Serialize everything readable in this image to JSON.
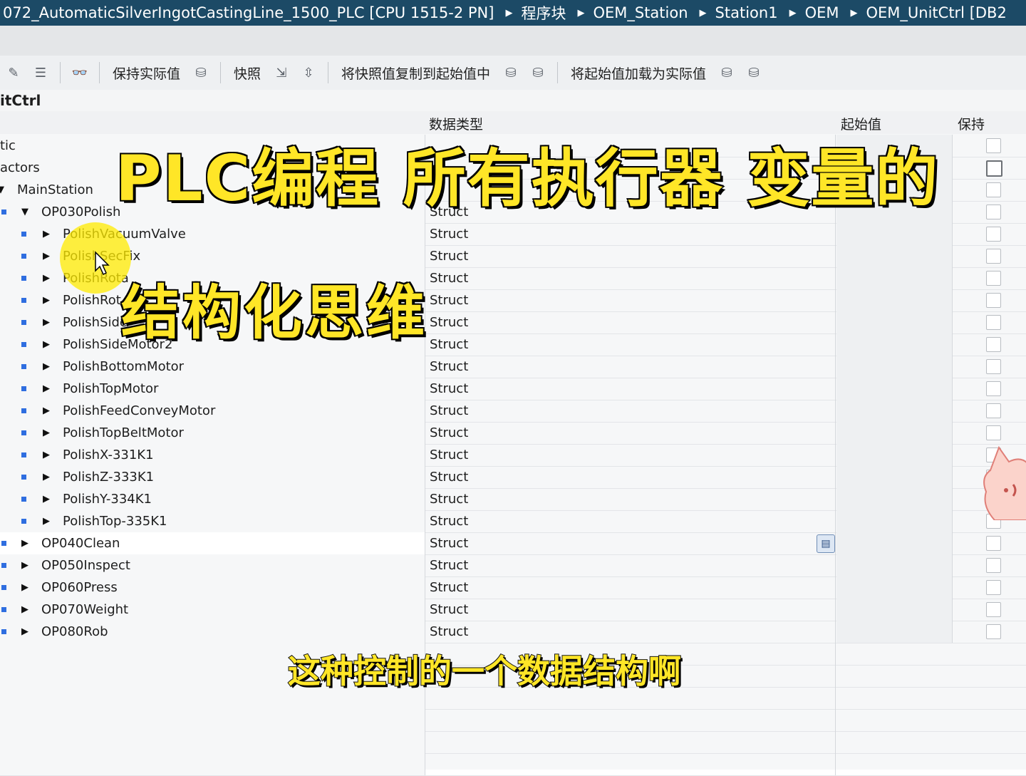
{
  "breadcrumb": {
    "items": [
      "072_AutomaticSilverIngotCastingLine_1500_PLC [CPU 1515-2 PN]",
      "程序块",
      "OEM_Station",
      "Station1",
      "OEM",
      "OEM_UnitCtrl [DB2"
    ]
  },
  "toolbar": {
    "keep_actual": "保持实际值",
    "snapshot": "快照",
    "copy_snapshot": "将快照值复制到起始值中",
    "load_start": "将起始值加载为实际值"
  },
  "block": {
    "title": "itCtrl"
  },
  "columns": {
    "name": "",
    "data_type": "数据类型",
    "start_value": "起始值",
    "retain": "保持"
  },
  "rows": [
    {
      "name": "tic",
      "type": "",
      "level": 0,
      "expanded": null,
      "bullet": false
    },
    {
      "name": "actors",
      "type": "",
      "level": 0,
      "expanded": null,
      "bullet": false
    },
    {
      "name": "MainStation",
      "type": "",
      "level": 1,
      "expanded": true,
      "bullet": false
    },
    {
      "name": "OP030Polish",
      "type": "Struct",
      "level": 2,
      "expanded": true,
      "bullet": true
    },
    {
      "name": "PolishVacuumValve",
      "type": "Struct",
      "level": 3,
      "expanded": false,
      "bullet": true
    },
    {
      "name": "PolishSecFix",
      "type": "Struct",
      "level": 3,
      "expanded": false,
      "bullet": true
    },
    {
      "name": "PolishRota",
      "type": "Struct",
      "level": 3,
      "expanded": false,
      "bullet": true
    },
    {
      "name": "PolishRot",
      "type": "Struct",
      "level": 3,
      "expanded": false,
      "bullet": true
    },
    {
      "name": "PolishSide",
      "type": "Struct",
      "level": 3,
      "expanded": false,
      "bullet": true
    },
    {
      "name": "PolishSideMotor2",
      "type": "Struct",
      "level": 3,
      "expanded": false,
      "bullet": true
    },
    {
      "name": "PolishBottomMotor",
      "type": "Struct",
      "level": 3,
      "expanded": false,
      "bullet": true
    },
    {
      "name": "PolishTopMotor",
      "type": "Struct",
      "level": 3,
      "expanded": false,
      "bullet": true
    },
    {
      "name": "PolishFeedConveyMotor",
      "type": "Struct",
      "level": 3,
      "expanded": false,
      "bullet": true
    },
    {
      "name": "PolishTopBeltMotor",
      "type": "Struct",
      "level": 3,
      "expanded": false,
      "bullet": true
    },
    {
      "name": "PolishX-331K1",
      "type": "Struct",
      "level": 3,
      "expanded": false,
      "bullet": true
    },
    {
      "name": "PolishZ-333K1",
      "type": "Struct",
      "level": 3,
      "expanded": false,
      "bullet": true
    },
    {
      "name": "PolishY-334K1",
      "type": "Struct",
      "level": 3,
      "expanded": false,
      "bullet": true
    },
    {
      "name": "PolishTop-335K1",
      "type": "Struct",
      "level": 3,
      "expanded": false,
      "bullet": true
    },
    {
      "name": "OP040Clean",
      "type": "Struct",
      "level": 2,
      "expanded": false,
      "bullet": true,
      "selected": true
    },
    {
      "name": "OP050Inspect",
      "type": "Struct",
      "level": 2,
      "expanded": false,
      "bullet": true
    },
    {
      "name": "OP060Press",
      "type": "Struct",
      "level": 2,
      "expanded": false,
      "bullet": true
    },
    {
      "name": "OP070Weight",
      "type": "Struct",
      "level": 2,
      "expanded": false,
      "bullet": true
    },
    {
      "name": "OP080Rob",
      "type": "Struct",
      "level": 2,
      "expanded": false,
      "bullet": true
    }
  ],
  "overlay": {
    "title_line1": "PLC编程 所有执行器 变量的",
    "title_line2": "结构化思维",
    "subtitle": "这种控制的一个数据结构啊"
  },
  "colors": {
    "breadcrumb_bg": "#1c4a66",
    "caption": "#ffe627",
    "bullet": "#2f6ee0"
  }
}
